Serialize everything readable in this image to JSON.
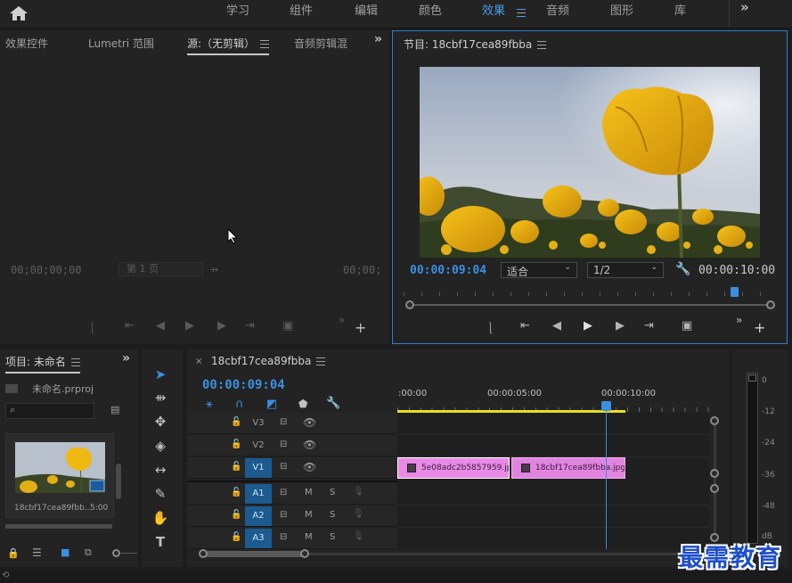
{
  "workspaces": [
    "学习",
    "组件",
    "编辑",
    "颜色",
    "效果",
    "音频",
    "图形",
    "库"
  ],
  "source_panel": {
    "tabs": [
      "效果控件",
      "Lumetri 范围",
      "源:（无剪辑）",
      "音频剪辑混"
    ],
    "timecode_left": "00;00;00;00",
    "page_label": "第 1 页",
    "timecode_right": "00;00;"
  },
  "program_panel": {
    "title": "节目: 18cbf17cea89fbba",
    "timecode": "00:00:09:04",
    "fit": "适合",
    "resolution": "1/2",
    "duration": "00:00:10:00",
    "playhead_fraction": 0.91
  },
  "project_panel": {
    "tab": "项目: 未命名",
    "file": "未命名.prproj",
    "clip_name": "18cbf17cea89fbb...",
    "clip_duration": "5:00"
  },
  "timeline": {
    "tab": "18cbf17cea89fbba",
    "timecode": "00:00:09:04",
    "ruler": [
      ":00:00",
      "00:00:05:00",
      "00:00:10:00"
    ],
    "video_tracks": [
      "V3",
      "V2",
      "V1"
    ],
    "audio_tracks": [
      "A1",
      "A2",
      "A3"
    ],
    "clips": [
      "5e08adc2b5857959.jp",
      "18cbf17cea89fbba.jpg"
    ],
    "m_label": "M",
    "s_label": "S"
  },
  "meter": {
    "labels": [
      "0",
      "-12",
      "-24",
      "-36",
      "-48",
      "dB"
    ]
  },
  "watermark": "最需教育",
  "colors": {
    "accent": "#3b8fe0",
    "clip": "#e184e0",
    "work_area": "#e8e020"
  }
}
